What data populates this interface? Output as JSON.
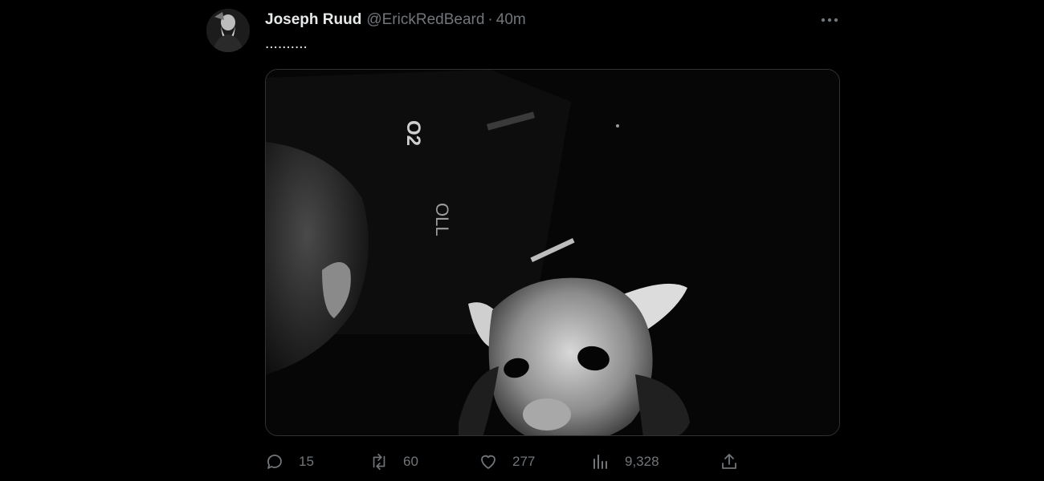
{
  "tweet": {
    "author_name": "Joseph Ruud",
    "author_handle": "@ErickRedBeard",
    "separator": "·",
    "timestamp": "40m",
    "text": "..........",
    "media_text_1": "O2",
    "media_text_2": "OLL"
  },
  "actions": {
    "reply": {
      "icon": "reply-icon",
      "count": "15"
    },
    "retweet": {
      "icon": "retweet-icon",
      "count": "60"
    },
    "like": {
      "icon": "heart-icon",
      "count": "277"
    },
    "views": {
      "icon": "views-icon",
      "count": "9,328"
    },
    "share": {
      "icon": "share-icon"
    }
  },
  "colors": {
    "background": "#000000",
    "primary_text": "#e7e9ea",
    "secondary_text": "#71767b",
    "border": "#2f3336"
  }
}
